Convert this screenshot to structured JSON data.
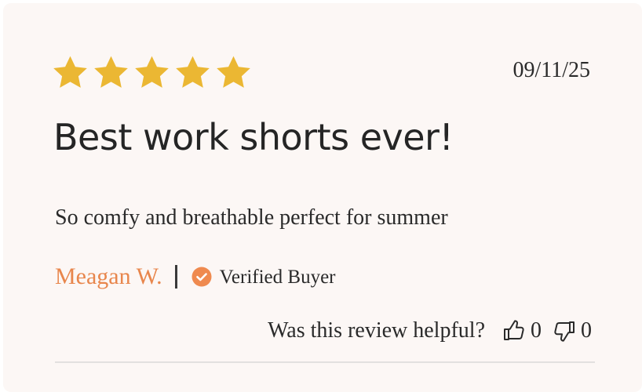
{
  "review": {
    "rating": 5,
    "rating_max": 5,
    "date": "09/11/25",
    "title": "Best work shorts ever!",
    "body": "So comfy and breathable perfect for summer",
    "author": "Meagan W.",
    "verified_label": "Verified Buyer",
    "helpful_label": "Was this review helpful?",
    "helpful_up_count": "0",
    "helpful_down_count": "0"
  },
  "colors": {
    "star": "#ebb733",
    "author": "#e8864c",
    "verified_badge": "#ef8a4f",
    "card_background": "#fcf7f5",
    "text": "#2a2a2a"
  },
  "icons": {
    "star": "star-icon",
    "verified": "check-circle-icon",
    "thumbs_up": "thumbs-up-icon",
    "thumbs_down": "thumbs-down-icon"
  }
}
